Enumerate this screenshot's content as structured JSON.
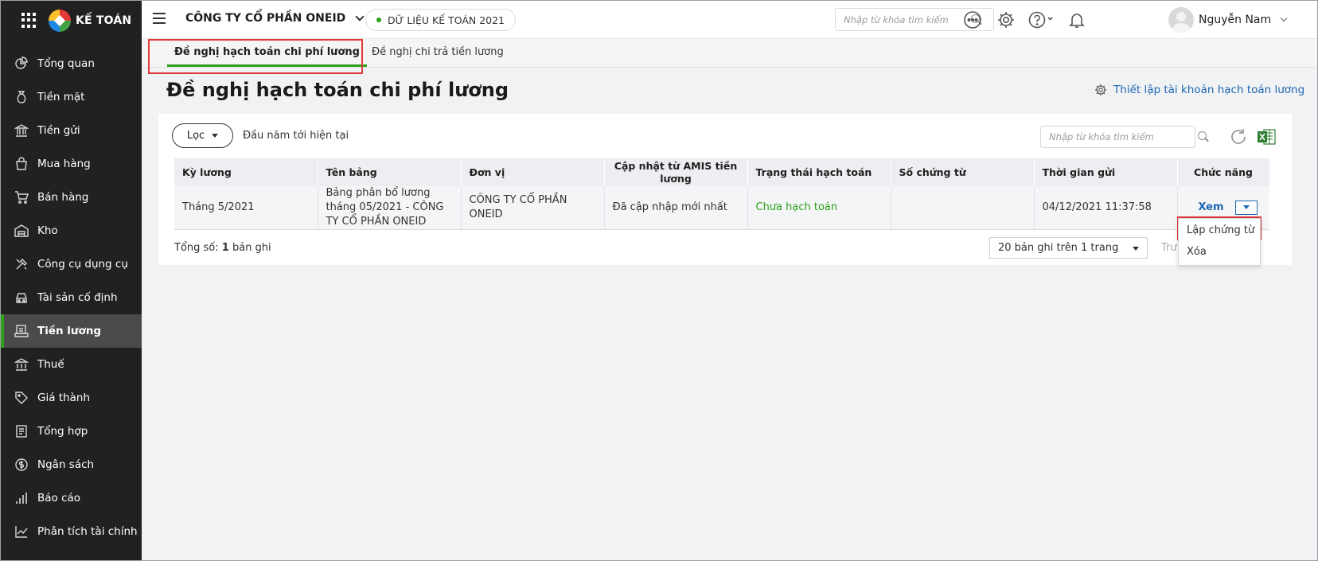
{
  "sidebar": {
    "brand": "KẾ TOÁN",
    "items": [
      {
        "label": "Tổng quan",
        "icon": "dashboard-icon"
      },
      {
        "label": "Tiền mặt",
        "icon": "money-bag-icon"
      },
      {
        "label": "Tiền gửi",
        "icon": "bank-icon"
      },
      {
        "label": "Mua hàng",
        "icon": "shopping-bag-icon"
      },
      {
        "label": "Bán hàng",
        "icon": "cart-icon"
      },
      {
        "label": "Kho",
        "icon": "warehouse-icon"
      },
      {
        "label": "Công cụ dụng cụ",
        "icon": "tools-icon"
      },
      {
        "label": "Tài sản cố định",
        "icon": "car-icon"
      },
      {
        "label": "Tiền lương",
        "icon": "payroll-icon",
        "active": true
      },
      {
        "label": "Thuế",
        "icon": "tax-icon"
      },
      {
        "label": "Giá thành",
        "icon": "tag-icon"
      },
      {
        "label": "Tổng hợp",
        "icon": "ledger-icon"
      },
      {
        "label": "Ngân sách",
        "icon": "budget-icon"
      },
      {
        "label": "Báo cáo",
        "icon": "report-icon"
      },
      {
        "label": "Phân tích tài chính",
        "icon": "analysis-icon"
      }
    ]
  },
  "header": {
    "company": "CÔNG TY CỔ PHẦN ONEID",
    "data_label": "DỮ LIỆU KẾ TOÁN 2021",
    "search_placeholder": "Nhập từ khóa tìm kiếm",
    "user_name": "Nguyễn Nam"
  },
  "tabs": [
    "Đề nghị hạch toán chi phí lương",
    "Đề nghị chi trả tiền lương"
  ],
  "main": {
    "title": "Đề nghị hạch toán chi phí lương",
    "settings_link": "Thiết lập tài khoản hạch toán lương",
    "filter_label": "Lọc",
    "period": "Đầu năm tới hiện tại",
    "search_placeholder": "Nhập từ khóa tìm kiếm"
  },
  "table": {
    "headers": [
      "Kỳ lương",
      "Tên bảng",
      "Đơn vị",
      "Cập nhật từ AMIS tiền lương",
      "Trạng thái hạch toán",
      "Số chứng từ",
      "Thời gian gửi",
      "Chức năng"
    ],
    "rows": [
      {
        "ky_luong": "Tháng 5/2021",
        "ten_bang": "Bảng phân bổ lương tháng 05/2021 - CÔNG TY CỔ PHẦN ONEID",
        "don_vi": "CÔNG TY CỔ PHẦN ONEID",
        "cap_nhat": "Đã cập nhập mới nhất",
        "trang_thai": "Chưa hạch toán",
        "so_chung_tu": "",
        "thoi_gian": "04/12/2021 11:37:58",
        "action": "Xem"
      }
    ]
  },
  "footer": {
    "total_prefix": "Tổng số:",
    "total_count": "1",
    "total_suffix": "bản ghi",
    "page_size": "20 bản ghi trên 1 trang",
    "prev": "Trư"
  },
  "dropdown": [
    "Lập chứng từ",
    "Xóa"
  ],
  "colors": {
    "accent": "#2ca01c",
    "link": "#1f67b2",
    "highlight": "#e2393a",
    "sidebar": "#212121"
  }
}
